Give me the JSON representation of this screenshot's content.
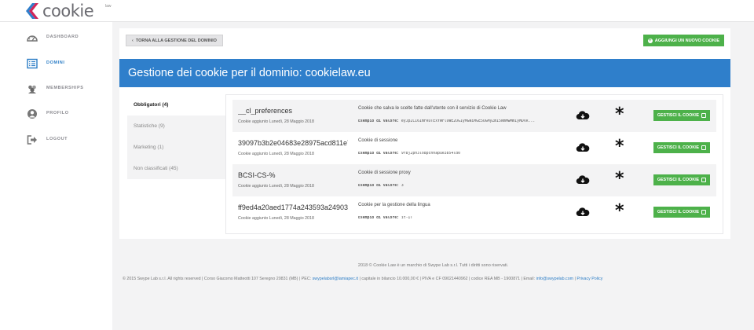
{
  "brand": {
    "name": "cookie",
    "sup": "law"
  },
  "colors": {
    "primary": "#2f7fcb",
    "success": "#4db14a",
    "sidebar_active": "#2c7dc6"
  },
  "sidebar": {
    "items": [
      {
        "label": "DASHBOARD",
        "icon": "dashboard-icon",
        "active": false
      },
      {
        "label": "DOMINI",
        "icon": "list-icon",
        "active": true
      },
      {
        "label": "MEMBERSHIPS",
        "icon": "users-icon",
        "active": false
      },
      {
        "label": "PROFILO",
        "icon": "user-icon",
        "active": false
      },
      {
        "label": "LOGOUT",
        "icon": "logout-icon",
        "active": false
      }
    ]
  },
  "toolbar": {
    "back_label": "TORNA ALLA GESTIONE DEL DOMINIO",
    "add_label": "AGGIUNGI UN NUOVO COOKIE"
  },
  "page_title": "Gestione dei cookie per il dominio: cookielaw.eu",
  "tabs": [
    {
      "label": "Obbligatori (4)",
      "active": true
    },
    {
      "label": "Statistiche (9)",
      "active": false
    },
    {
      "label": "Marketing (1)",
      "active": false
    },
    {
      "label": "Non classificati (45)",
      "active": false
    }
  ],
  "example_label": "Esempio di valore:",
  "manage_label": "GESTISCI IL COOKIE",
  "cookies": [
    {
      "name": "__cl_preferences",
      "added": "Cookie aggiunto Lunedì, 28 Maggio 2018",
      "description": "Cookie che salva le scelte fatte dall'utente con il servizio di Cookie Law",
      "example": "eyJpZCI6ImFkOTExYWFlOWE2OGIyMGNiMGE5OGMyZmI5NmMwMmIyMDVk..."
    },
    {
      "name": "39097b3b2e04683e28975acd811e7...",
      "added": "Cookie aggiunto Lunedì, 28 Maggio 2018",
      "description": "Cookie di sessione",
      "example": "9f8j2ph3lo8pcnhapue3b54ld0"
    },
    {
      "name": "BCSI-CS-%",
      "added": "Cookie aggiunto Lunedì, 28 Maggio 2018",
      "description": "Cookie di sessione proxy",
      "example": "3"
    },
    {
      "name": "ff9ed4a20aed1774a243593a249033...",
      "added": "Cookie aggiunto Lunedì, 28 Maggio 2018",
      "description": "Cookie per la gestione della lingua",
      "example": "it-IT"
    }
  ],
  "footer": {
    "line1": "2018 © Cookie Law è un marchio di Swype Lab s.r.l. Tutti i diritti sono riservati.",
    "line2_prefix": "© 2015 Swype Lab s.r.l. All rights reserved | Corso Giacomo Matteotti 107 Seregno 20831 (MB) | PEC:",
    "pec": "swypelabsrl@lamiapec.it",
    "line2_middle": "| capitale in bilancio 10.000,00 € | PIVA e CF 09021440962 | codice REA MB - 1900871 | Email:",
    "email": "info@swypelab.com",
    "sep": "|",
    "privacy": "Privacy Policy"
  }
}
